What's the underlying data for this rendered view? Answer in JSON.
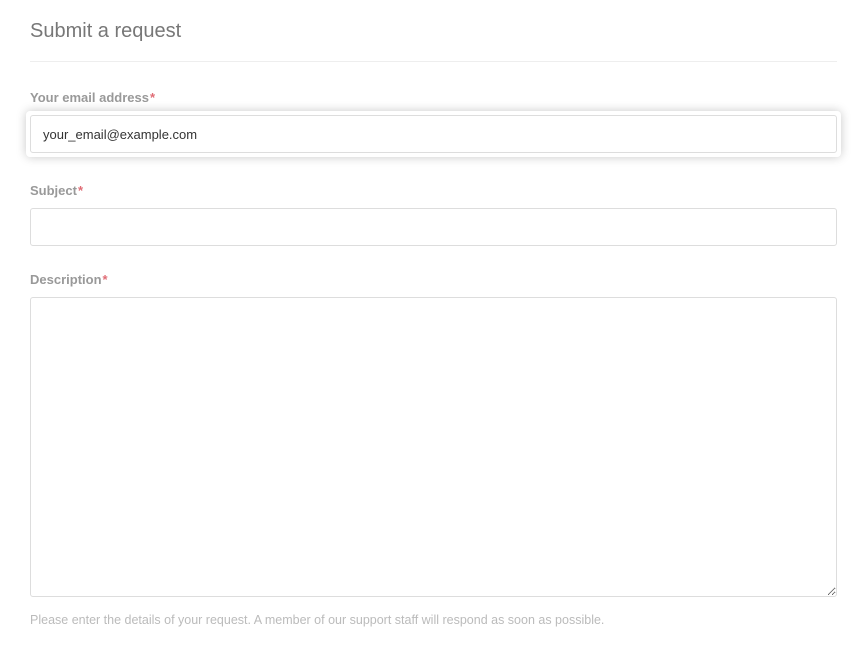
{
  "title": "Submit a request",
  "required_marker": "*",
  "fields": {
    "email": {
      "label": "Your email address",
      "value": "your_email@example.com"
    },
    "subject": {
      "label": "Subject",
      "value": ""
    },
    "description": {
      "label": "Description",
      "value": "",
      "helper": "Please enter the details of your request. A member of our support staff will respond as soon as possible."
    }
  }
}
